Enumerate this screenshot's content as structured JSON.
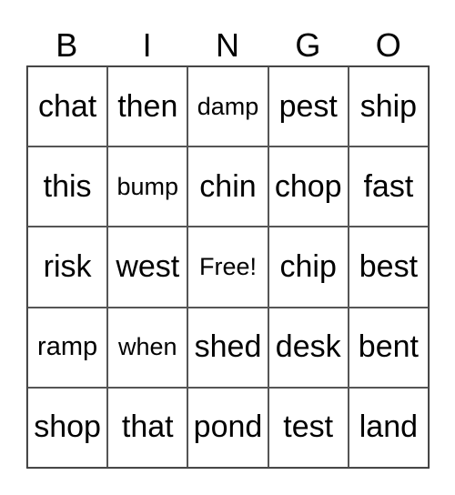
{
  "header": [
    "B",
    "I",
    "N",
    "G",
    "O"
  ],
  "cells": [
    [
      "chat",
      "then",
      "damp",
      "pest",
      "ship"
    ],
    [
      "this",
      "bump",
      "chin",
      "chop",
      "fast"
    ],
    [
      "risk",
      "west",
      "Free!",
      "chip",
      "best"
    ],
    [
      "ramp",
      "when",
      "shed",
      "desk",
      "bent"
    ],
    [
      "shop",
      "that",
      "pond",
      "test",
      "land"
    ]
  ]
}
